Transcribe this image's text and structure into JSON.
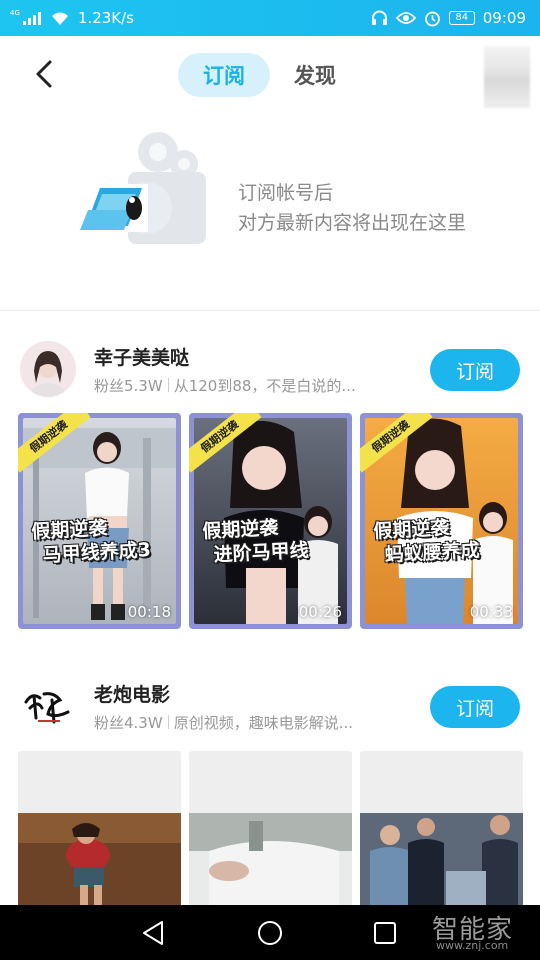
{
  "status_bar": {
    "network_type": "4G",
    "speed": "1.23K/s",
    "battery": "84",
    "time": "09:09"
  },
  "header": {
    "tabs": [
      {
        "label": "订阅",
        "active": true
      },
      {
        "label": "发现",
        "active": false
      }
    ]
  },
  "empty_state": {
    "line1": "订阅帐号后",
    "line2": "对方最新内容将出现在这里"
  },
  "accounts": [
    {
      "name": "幸子美美哒",
      "fans": "粉丝5.3W",
      "desc": "从120到88，不是白说的...",
      "subscribe_label": "订阅",
      "videos": [
        {
          "badge": "假期逆袭",
          "title_l1": "假期逆袭",
          "title_l2": "马甲线养成3",
          "duration": "00:18",
          "colors": [
            "#cfd3d8",
            "#9aa0a8"
          ]
        },
        {
          "badge": "假期逆袭",
          "title_l1": "假期逆袭",
          "title_l2": "进阶马甲线",
          "duration": "00:26",
          "colors": [
            "#5b6170",
            "#2a2d35"
          ]
        },
        {
          "badge": "假期逆袭",
          "title_l1": "假期逆袭",
          "title_l2": "蚂蚁腰养成",
          "duration": "00:33",
          "colors": [
            "#f2a33a",
            "#d9822a"
          ]
        }
      ]
    },
    {
      "name": "老炮电影",
      "fans": "粉丝4.3W",
      "desc": "原创视频，趣味电影解说...",
      "subscribe_label": "订阅",
      "videos": [
        {
          "colors": [
            "#7a4a2a",
            "#3a2214"
          ]
        },
        {
          "colors": [
            "#c9cbc8",
            "#9aa09a"
          ]
        },
        {
          "colors": [
            "#556070",
            "#2d3440"
          ]
        }
      ]
    }
  ],
  "watermark": {
    "brand": "智能家",
    "url": "www.znj.com"
  }
}
